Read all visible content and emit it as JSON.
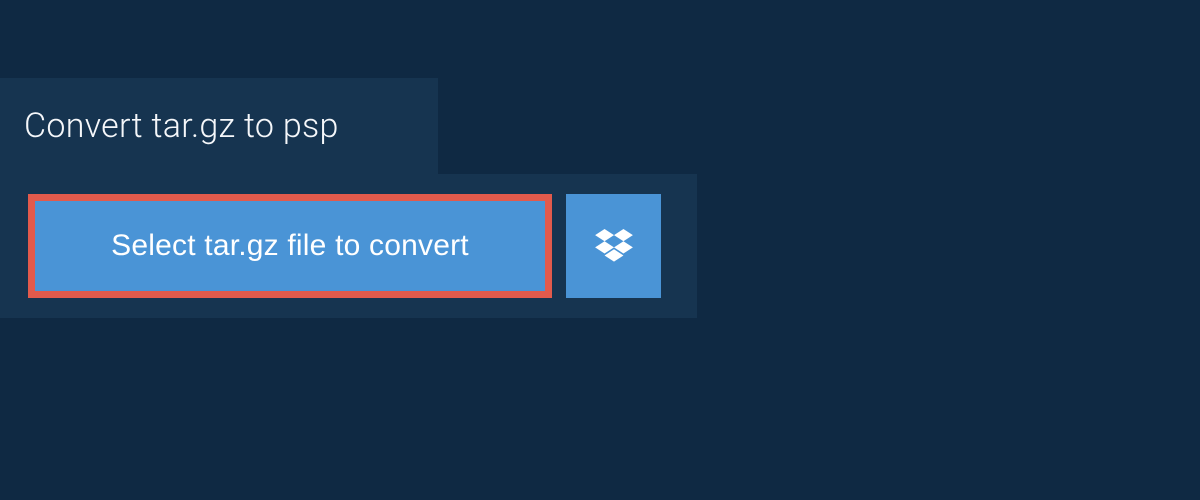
{
  "header": {
    "title": "Convert tar.gz to psp"
  },
  "main": {
    "select_button_label": "Select tar.gz file to convert"
  },
  "colors": {
    "background": "#0f2943",
    "panel": "#163450",
    "accent": "#4a94d6",
    "highlight_border": "#e25a4c",
    "text": "#ffffff"
  }
}
